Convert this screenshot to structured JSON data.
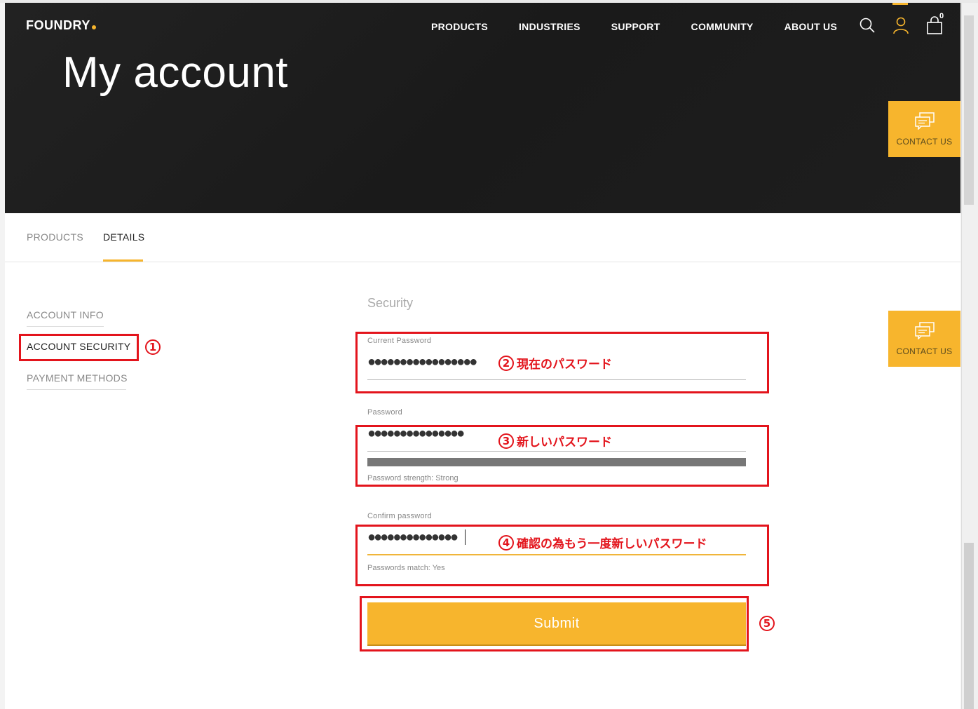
{
  "brand": {
    "name": "FOUNDRY",
    "accent": "#f7b52d"
  },
  "nav": {
    "items": [
      "PRODUCTS",
      "INDUSTRIES",
      "SUPPORT",
      "COMMUNITY",
      "ABOUT US"
    ],
    "cart_count": "0"
  },
  "hero": {
    "title": "My account"
  },
  "contact": {
    "label": "CONTACT US"
  },
  "tabs": [
    {
      "label": "PRODUCTS",
      "active": false
    },
    {
      "label": "DETAILS",
      "active": true
    }
  ],
  "sidebar": {
    "items": [
      {
        "label": "ACCOUNT INFO"
      },
      {
        "label": "ACCOUNT SECURITY"
      },
      {
        "label": "PAYMENT METHODS"
      }
    ]
  },
  "security": {
    "title": "Security",
    "current_password": {
      "label": "Current Password",
      "value": "●●●●●●●●●●●●●●●●●"
    },
    "password": {
      "label": "Password",
      "value": "●●●●●●●●●●●●●●●",
      "strength": "Password strength: Strong"
    },
    "confirm": {
      "label": "Confirm password",
      "value": "●●●●●●●●●●●●●●",
      "match": "Passwords match: Yes"
    },
    "submit": "Submit"
  },
  "annotations": {
    "a1": {
      "num": "1"
    },
    "a2": {
      "num": "2",
      "text": "現在のパスワード"
    },
    "a3": {
      "num": "3",
      "text": "新しいパスワード"
    },
    "a4": {
      "num": "4",
      "text": "確認の為もう一度新しいパスワード"
    },
    "a5": {
      "num": "5"
    },
    "color": "#e3141c"
  }
}
